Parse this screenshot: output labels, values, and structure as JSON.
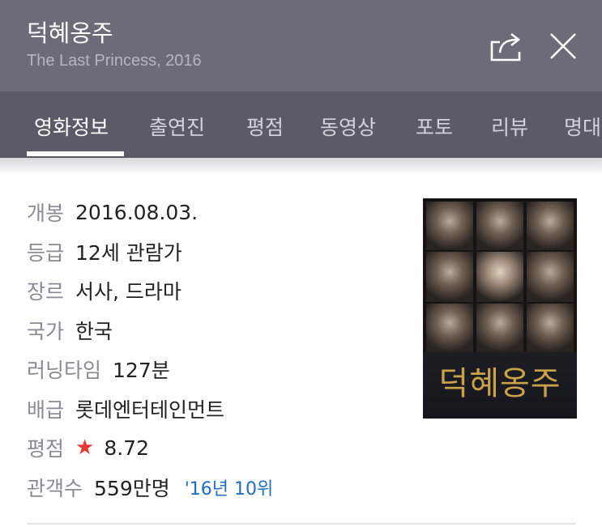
{
  "header": {
    "title": "덕혜옹주",
    "subtitle": "The Last Princess, 2016",
    "share_icon": "share-icon",
    "close_icon": "close-icon"
  },
  "tabs": [
    {
      "label": "영화정보",
      "active": true
    },
    {
      "label": "출연진",
      "active": false
    },
    {
      "label": "평점",
      "active": false
    },
    {
      "label": "동영상",
      "active": false
    },
    {
      "label": "포토",
      "active": false
    },
    {
      "label": "리뷰",
      "active": false
    },
    {
      "label": "명대",
      "active": false
    }
  ],
  "info": {
    "release": {
      "label": "개봉",
      "value": "2016.08.03."
    },
    "rating": {
      "label": "등급",
      "value": "12세 관람가"
    },
    "genre": {
      "label": "장르",
      "value": "서사, 드라마"
    },
    "country": {
      "label": "국가",
      "value": "한국"
    },
    "runtime": {
      "label": "러닝타임",
      "value": "127분"
    },
    "distributor": {
      "label": "배급",
      "value": "롯데엔터테인먼트"
    },
    "score": {
      "label": "평점",
      "star": "★",
      "value": "8.72"
    },
    "audience": {
      "label": "관객수",
      "value": "559만명",
      "rank": "'16년 10위"
    }
  },
  "poster": {
    "title": "덕혜옹주"
  },
  "colors": {
    "header_bg": "#6b6c78",
    "tabs_bg": "#5a5b67",
    "star": "#e53935",
    "rank_link": "#1e6ec7"
  }
}
